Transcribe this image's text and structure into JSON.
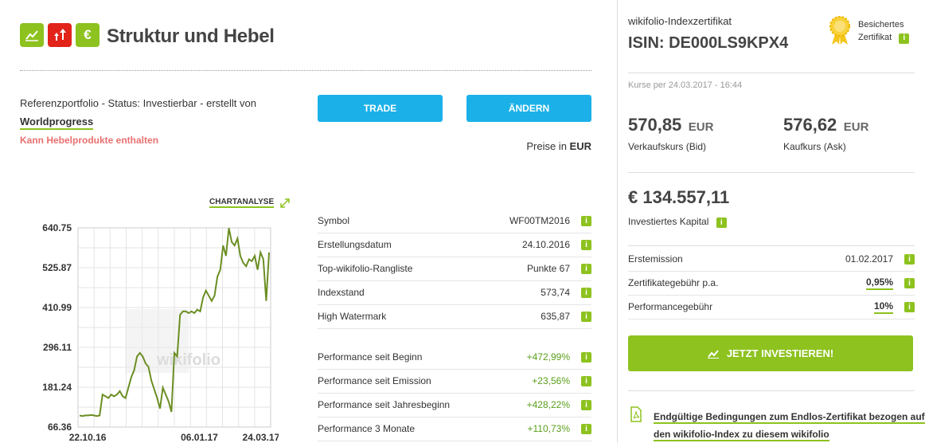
{
  "header": {
    "title": "Struktur und Hebel",
    "icons": [
      {
        "name": "trend-up-icon",
        "color": "#8dc21f"
      },
      {
        "name": "leverage-arrows-icon",
        "color": "#e2231a"
      },
      {
        "name": "euro-icon",
        "color": "#8dc21f"
      }
    ]
  },
  "status": {
    "line1": "Referenzportfolio - Status: Investierbar - erstellt von",
    "author": "Worldprogress",
    "leverage_note": "Kann Hebelprodukte enthalten"
  },
  "buttons": {
    "trade": "TRADE",
    "change": "ÄNDERN"
  },
  "prices_in": {
    "label": "Preise in",
    "currency": "EUR"
  },
  "chartanalyse": "CHARTANALYSE",
  "chart_data": {
    "type": "line",
    "y_ticks": [
      "640.75",
      "525.87",
      "410.99",
      "296.11",
      "181.24",
      "66.36"
    ],
    "x_ticks": [
      "22.10.16",
      "06.01.17",
      "24.03.17"
    ],
    "ylim": [
      66.36,
      640.75
    ],
    "series": [
      {
        "color": "#6b8e23",
        "values": [
          100,
          98,
          100,
          100,
          101,
          100,
          98,
          100,
          160,
          155,
          150,
          160,
          155,
          160,
          170,
          155,
          150,
          180,
          210,
          230,
          270,
          280,
          270,
          250,
          240,
          200,
          175,
          150,
          120,
          180,
          160,
          140,
          110,
          280,
          270,
          390,
          400,
          400,
          395,
          400,
          395,
          405,
          400,
          440,
          460,
          445,
          430,
          445,
          500,
          520,
          590,
          560,
          640,
          600,
          590,
          610,
          560,
          540,
          530,
          550,
          545,
          560,
          520,
          570,
          550,
          430,
          570
        ]
      }
    ],
    "grid": true
  },
  "watermark": "wikifolio",
  "table1": [
    {
      "label": "Symbol",
      "value": "WF00TM2016",
      "green": false
    },
    {
      "label": "Erstellungsdatum",
      "value": "24.10.2016",
      "green": false
    },
    {
      "label": "Top-wikifolio-Rangliste",
      "value": "Punkte 67",
      "green": false
    },
    {
      "label": "Indexstand",
      "value": "573,74",
      "green": false
    },
    {
      "label": "High Watermark",
      "value": "635,87",
      "green": false
    }
  ],
  "table2": [
    {
      "label": "Performance seit Beginn",
      "value": "+472,99%",
      "green": true
    },
    {
      "label": "Performance seit Emission",
      "value": "+23,56%",
      "green": true
    },
    {
      "label": "Performance seit Jahresbeginn",
      "value": "+428,22%",
      "green": true
    },
    {
      "label": "Performance 3 Monate",
      "value": "+110,73%",
      "green": true
    }
  ],
  "info_badge": "i",
  "right": {
    "cert_label": "wikifolio-Indexzertifikat",
    "isin": "ISIN: DE000LS9KPX4",
    "secured_line1": "Besichertes",
    "secured_line2": "Zertifikat",
    "price_date": "Kurse per 24.03.2017 - 16:44",
    "bid_value": "570,85",
    "bid_currency": "EUR",
    "bid_label": "Verkaufskurs (Bid)",
    "ask_value": "576,62",
    "ask_currency": "EUR",
    "ask_label": "Kaufkurs (Ask)",
    "capital": "€ 134.557,11",
    "capital_label": "Investiertes Kapital",
    "rows": [
      {
        "label": "Erstemission",
        "value": "01.02.2017",
        "underline": false
      },
      {
        "label": "Zertifikategebühr p.a.",
        "value": "0,95%",
        "underline": true
      },
      {
        "label": "Performancegebühr",
        "value": "10%",
        "underline": true
      }
    ],
    "invest_button": "JETZT INVESTIEREN!",
    "pdf_link_line1": "Endgültige Bedingungen zum Endlos-Zertifikat bezogen auf",
    "pdf_link_line2": "den wikifolio-Index zu diesem wikifolio"
  }
}
